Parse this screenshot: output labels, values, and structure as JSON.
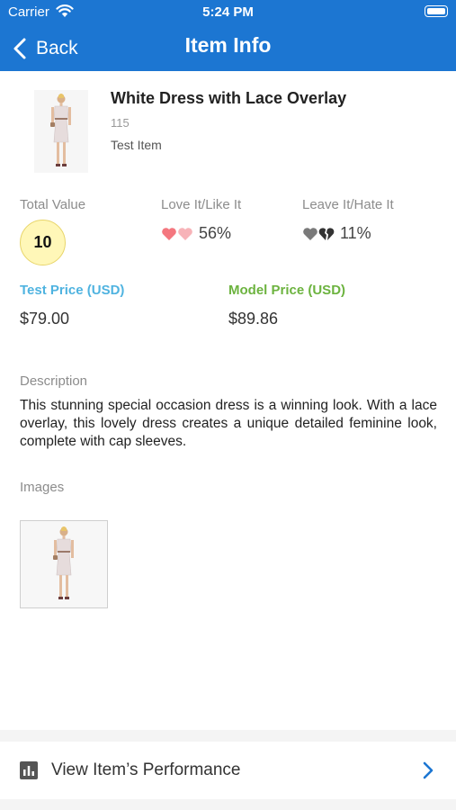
{
  "status_bar": {
    "carrier": "Carrier",
    "time": "5:24 PM"
  },
  "nav": {
    "back_label": "Back",
    "title": "Item Info"
  },
  "item": {
    "title": "White Dress with Lace Overlay",
    "id": "115",
    "type": "Test Item"
  },
  "metrics": {
    "total_value_label": "Total Value",
    "total_value": "10",
    "love_label": "Love It/Like It",
    "love_value": "56%",
    "leave_label": "Leave It/Hate It",
    "leave_value": "11%"
  },
  "prices": {
    "test_label": "Test Price (USD)",
    "test_value": "$79.00",
    "model_label": "Model Price (USD)",
    "model_value": "$89.86"
  },
  "description": {
    "label": "Description",
    "text": "This stunning special occasion dress is a winning look. With a lace overlay, this lovely dress creates a unique detailed feminine look, complete with cap sleeves."
  },
  "images": {
    "label": "Images"
  },
  "performance": {
    "label": "View Item’s Performance"
  },
  "colors": {
    "header": "#1c76d2",
    "test_price": "#4fb3e0",
    "model_price": "#6cb33f",
    "love_heart": "#f4777f",
    "chevron": "#1c76d2"
  }
}
